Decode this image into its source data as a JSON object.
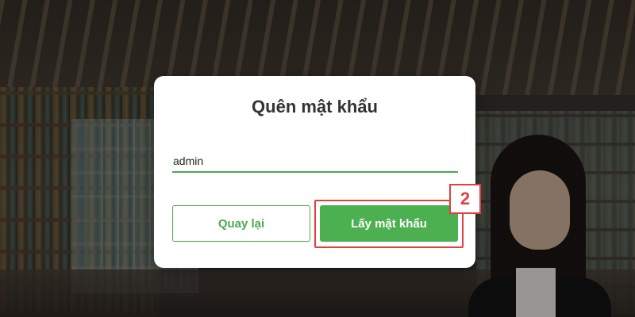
{
  "dialog": {
    "title": "Quên mật khẩu",
    "username_value": "admin",
    "back_label": "Quay lại",
    "get_password_label": "Lấy mật khẩu"
  },
  "annotation": {
    "step_number": "2"
  },
  "colors": {
    "accent": "#4caf50",
    "highlight": "#e04040"
  }
}
